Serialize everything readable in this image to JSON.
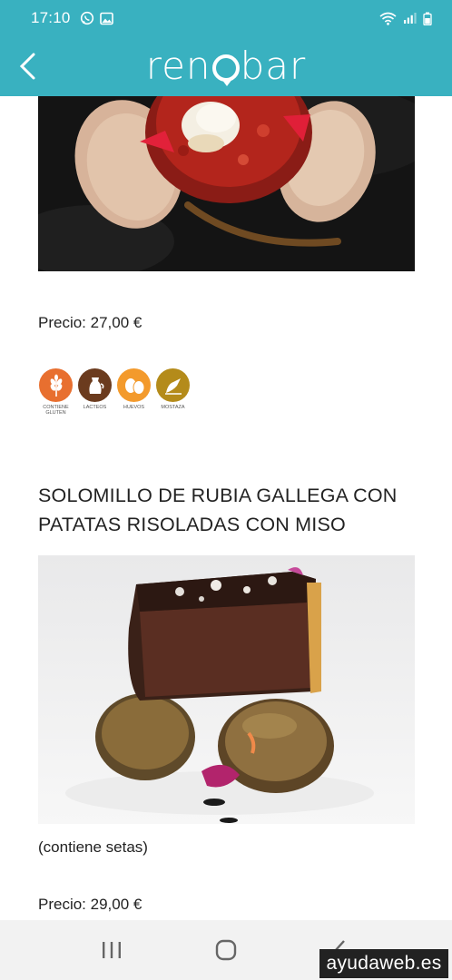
{
  "status_bar": {
    "time": "17:10",
    "left_icons": [
      "whatsapp-icon",
      "image-icon"
    ],
    "right_icons": [
      "wifi-icon",
      "signal-icon",
      "battery-icon"
    ]
  },
  "app_bar": {
    "brand": {
      "part1": "ren",
      "part2": "bar"
    },
    "background_color": "#39b1c0"
  },
  "dishes": [
    {
      "price": "Precio: 27,00 €",
      "allergens": [
        {
          "name": "wheat-icon",
          "label": "Contiene gluten",
          "color": "#e86f2f"
        },
        {
          "name": "milk-jug-icon",
          "label": "Lacteos",
          "color": "#6b3b1e"
        },
        {
          "name": "eggs-icon",
          "label": "Huevos",
          "color": "#f39a2c"
        },
        {
          "name": "mustard-icon",
          "label": "Mostaza",
          "color": "#b48b1a"
        }
      ]
    },
    {
      "title": "SOLOMILLO DE RUBIA GALLEGA CON PATATAS RISOLADAS CON MISO",
      "note": "(contiene setas)",
      "price": "Precio: 29,00 €"
    }
  ],
  "nav": {
    "buttons": [
      "recents-icon",
      "home-icon",
      "back-icon"
    ]
  },
  "watermark": "ayudaweb.es"
}
